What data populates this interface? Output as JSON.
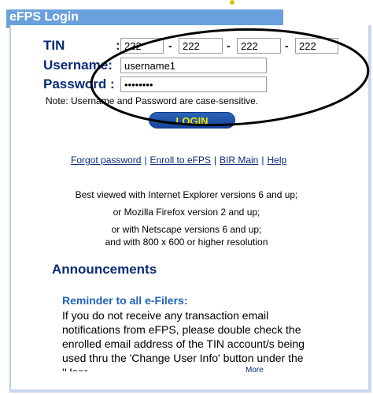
{
  "header": {
    "title": "eFPS Login"
  },
  "form": {
    "tin_label": "TIN",
    "username_label": "Username:",
    "password_label": "Password :",
    "tin_segments": [
      "222",
      "222",
      "222",
      "222"
    ],
    "username_value": "username1",
    "password_value": "••••••••",
    "note": "Note: Username and Password are case-sensitive.",
    "login_label": "LOGIN"
  },
  "links": [
    "Forgot password",
    "Enroll to eFPS",
    "BIR Main",
    "Help"
  ],
  "browser_notes": [
    "Best viewed with Internet Explorer versions 6 and up;",
    "or Mozilla Firefox version 2 and up;",
    "or with Netscape versions 6 and up;",
    "and with 800 x 600 or higher resolution"
  ],
  "announcements": {
    "title": "Announcements",
    "reminder_title": "Reminder to all e-Filers:",
    "reminder_body": "If you do not receive any transaction email notifications from eFPS, please double check the enrolled email address of the TIN account/s being used thru the 'Change User Info' button under the 'User",
    "more": "More"
  }
}
